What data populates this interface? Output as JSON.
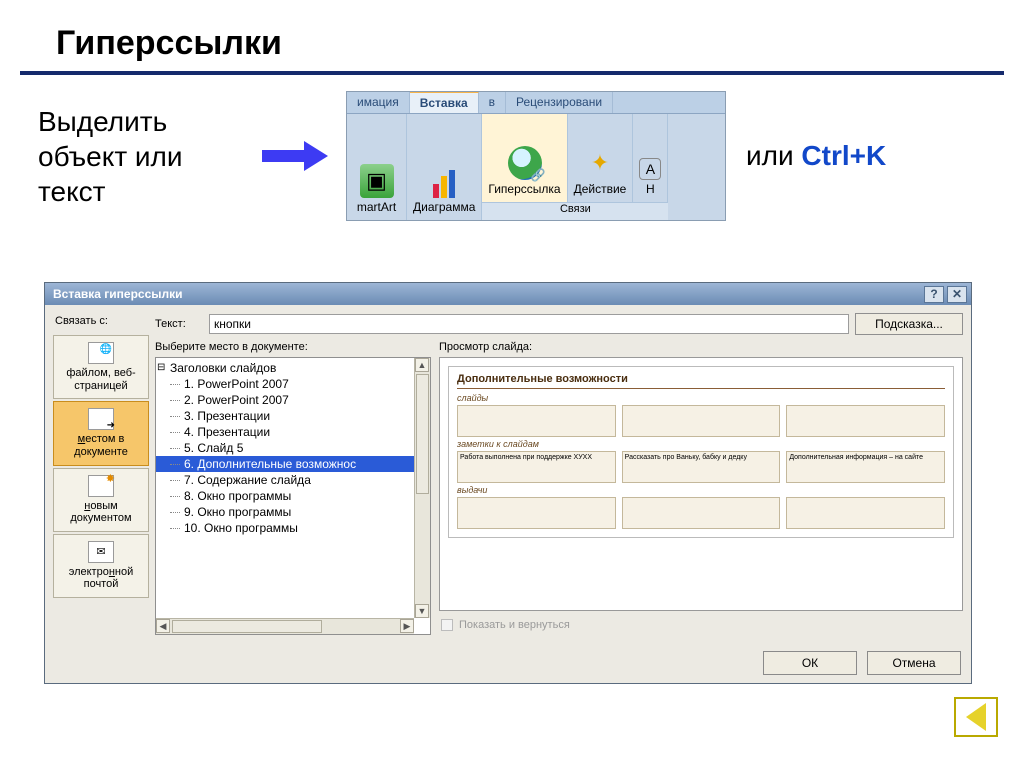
{
  "title": "Гиперссылки",
  "instruction": "Выделить объект или текст",
  "or_text": "или ",
  "shortcut": "Ctrl+K",
  "ribbon": {
    "tabs": [
      "имация",
      "Вставка",
      "в",
      "Рецензировани"
    ],
    "active_tab": "Вставка",
    "buttons": {
      "smartart": "martArt",
      "chart": "Диаграмма",
      "hyperlink": "Гиперссылка",
      "action": "Действие",
      "next": "Н"
    },
    "group_label": "Связи"
  },
  "dialog": {
    "title": "Вставка гиперссылки",
    "link_to_label": "Связать с:",
    "text_label": "Текст:",
    "text_value": "кнопки",
    "hint_button": "Подсказка...",
    "tree_label": "Выберите место в документе:",
    "tree_root": "Заголовки слайдов",
    "tree_items": [
      "1. PowerPoint 2007",
      "2. PowerPoint 2007",
      "3. Презентации",
      "4. Презентации",
      "5. Слайд 5",
      "6. Дополнительные возможнос",
      "7. Содержание слайда",
      "8. Окно программы",
      "9. Окно программы",
      "10. Окно программы"
    ],
    "tree_selected_index": 5,
    "preview_label": "Просмотр слайда:",
    "preview": {
      "slide_title": "Дополнительные возможности",
      "sections": [
        "слайды",
        "заметки к слайдам",
        "выдачи"
      ],
      "card1": "Работа выполнена при поддержке ХУХХ",
      "card2": "Рассказать про Ваньку, бабку и дедку",
      "card3": "Дополнительная информация – на сайте"
    },
    "show_return": "Показать и вернуться",
    "ok": "ОК",
    "cancel": "Отмена",
    "linkto": {
      "file_a": "файлом, веб-",
      "file_b": "страницей",
      "place_a": "местом в",
      "place_b": "документе",
      "newdoc_a": "новым",
      "newdoc_b": "документом",
      "email_a": "электронной",
      "email_b": "почтой"
    }
  }
}
